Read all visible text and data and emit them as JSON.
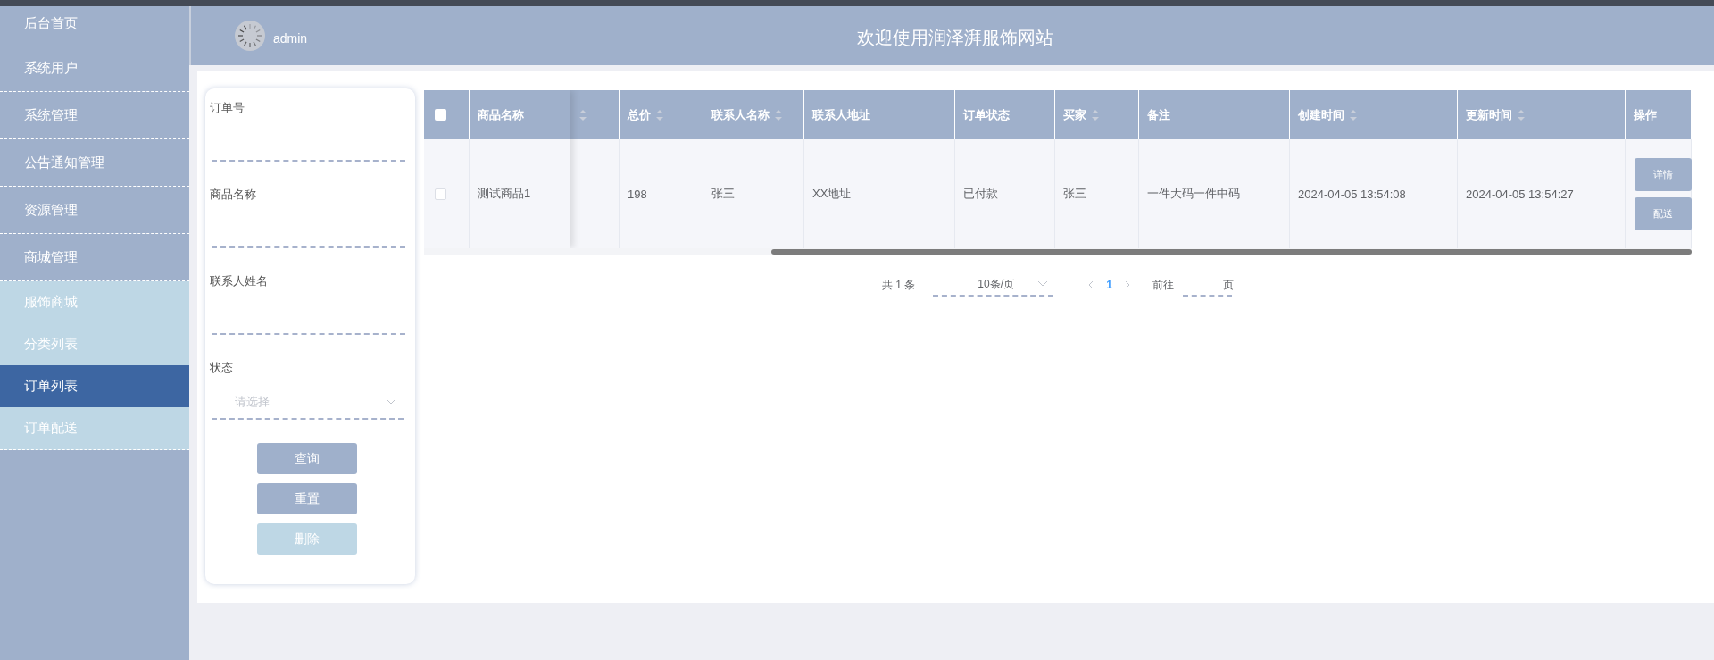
{
  "header": {
    "username": "admin",
    "title": "欢迎使用润泽湃服饰网站"
  },
  "sidebar": {
    "items": [
      {
        "label": "后台首页",
        "selected": false
      },
      {
        "label": "系统用户",
        "selected": false
      },
      {
        "label": "系统管理",
        "selected": false
      },
      {
        "label": "公告通知管理",
        "selected": false
      },
      {
        "label": "资源管理",
        "selected": false
      },
      {
        "label": "商城管理",
        "selected": false,
        "expanded": true,
        "children": [
          {
            "label": "服饰商城",
            "selected": false
          },
          {
            "label": "分类列表",
            "selected": false
          },
          {
            "label": "订单列表",
            "selected": true
          },
          {
            "label": "订单配送",
            "selected": false
          }
        ]
      }
    ]
  },
  "filter": {
    "fields": [
      {
        "kind": "text",
        "label": "订单号"
      },
      {
        "kind": "text",
        "label": "商品名称"
      },
      {
        "kind": "text",
        "label": "联系人姓名"
      },
      {
        "kind": "select",
        "label": "状态",
        "placeholder": "请选择"
      }
    ],
    "buttons": [
      {
        "label": "查询",
        "disabled": false
      },
      {
        "label": "重置",
        "disabled": false
      },
      {
        "label": "删除",
        "disabled": true
      }
    ]
  },
  "table": {
    "select_all": {
      "checked": false
    },
    "columns": [
      {
        "label": "商品名称",
        "sortable": false
      },
      {
        "sortable": true
      },
      {
        "label": "总价",
        "sortable": true
      },
      {
        "label": "联系人名称",
        "sortable": true
      },
      {
        "label": "联系人地址",
        "sortable": false
      },
      {
        "label": "订单状态",
        "sortable": false
      },
      {
        "label": "买家",
        "sortable": true
      },
      {
        "label": "备注",
        "sortable": false
      },
      {
        "label": "创建时间",
        "sortable": true
      },
      {
        "label": "更新时间",
        "sortable": true
      },
      {
        "label": "操作",
        "sortable": false
      }
    ],
    "rows": [
      {
        "checked": false,
        "cells": [
          "测试商品1",
          null,
          "198",
          "张三",
          "XX地址",
          "已付款",
          "张三",
          "一件大码一件中码",
          "2024-04-05 13:54:08",
          "2024-04-05 13:54:27"
        ],
        "actions": [
          "详情",
          "配送"
        ]
      }
    ]
  },
  "pagination": {
    "total": "共 1 条",
    "page_size": "10条/页",
    "pages": [
      {
        "label": "1",
        "selected": true
      }
    ],
    "goto_label": "前往",
    "page_unit": "页"
  }
}
